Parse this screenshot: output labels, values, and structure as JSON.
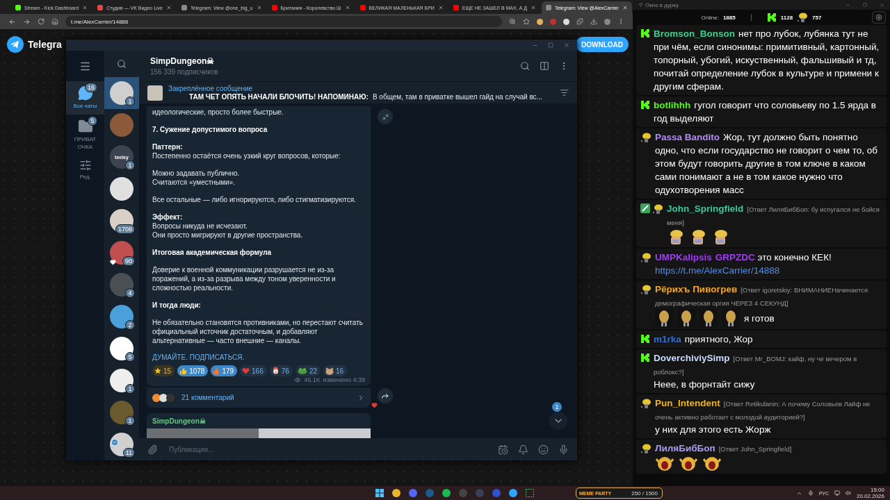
{
  "browser": {
    "tabs": [
      {
        "title": "Stream - Kick Dashboard",
        "kind": "kick",
        "selected": false
      },
      {
        "title": "Студия — VK Видео Live",
        "kind": "vk",
        "selected": false
      },
      {
        "title": "Telegram: View @one_big_u",
        "kind": "web",
        "selected": false
      },
      {
        "title": "Британия - Королевство Ш",
        "kind": "youtube",
        "selected": false
      },
      {
        "title": "ВЕЛИКАЯ МАЛЕНЬКАЯ БРИ",
        "kind": "youtube",
        "selected": false
      },
      {
        "title": "ЕЩЕ НЕ ЗАШЕЛ В MAX, А Д",
        "kind": "youtube",
        "selected": false
      },
      {
        "title": "Telegram: View @AlexCarrier",
        "kind": "web",
        "selected": true
      }
    ],
    "url": "t.me/AlexCarrier/14888"
  },
  "telegram_page": {
    "brand": "Telegra",
    "download_button": "DOWNLOAD"
  },
  "telegram_window": {
    "folders": [
      {
        "label": "Все чаты",
        "badge": "16",
        "kind": "chats",
        "selected": true
      },
      {
        "label": "ПРИВАТОЧКА",
        "badge": "5",
        "kind": "folder",
        "selected": false
      },
      {
        "label": "Ред.",
        "kind": "edit",
        "selected": false
      }
    ],
    "chats": [
      {
        "badge": "1",
        "kind": "plain",
        "selected": true
      },
      {
        "kind": "plain",
        "selected": false
      },
      {
        "label": "teelsy",
        "badge": "1",
        "kind": "text",
        "selected": false
      },
      {
        "kind": "plain",
        "selected": false
      },
      {
        "badge": "1708",
        "kind": "plain",
        "selected": false
      },
      {
        "badge": "90",
        "kind": "reacted",
        "selected": false
      },
      {
        "badge": "4",
        "kind": "plain",
        "selected": false
      },
      {
        "badge": "2",
        "kind": "plain",
        "selected": false
      },
      {
        "badge": "5",
        "kind": "plain",
        "selected": false
      },
      {
        "badge": "1",
        "kind": "plain",
        "selected": false
      },
      {
        "badge": "1",
        "kind": "plain",
        "selected": false
      },
      {
        "badge": "11",
        "kind": "verified",
        "selected": false
      }
    ],
    "channel": {
      "name": "SimpDungeon☠",
      "subscribers": "156 339 подписчиков"
    },
    "pinned": {
      "title": "Закреплённое сообщение",
      "text": "ТАМ ЧЕТ ОПЯТЬ НАЧАЛИ БЛОЧИТЬ! НАПОМИНАЮ:",
      "preview": "В общем, там в приватке вышел гайд на случай вс..."
    },
    "post": {
      "blocks": [
        {
          "lines": [
            "идеологические, просто более быстрые."
          ]
        },
        {
          "title": "7. Сужение допустимого вопроса"
        },
        {
          "title": "Паттерн:",
          "lines": [
            "Постепенно остаётся очень узкий круг вопросов, которые:"
          ]
        },
        {
          "lines": [
            "Можно задавать публично.",
            "Считаются «уместными»."
          ]
        },
        {
          "lines": [
            "Все остальные — либо игнорируются, либо стигматизируются."
          ]
        },
        {
          "title": "Эффект:",
          "lines": [
            "Вопросы никуда не исчезают.",
            "Они просто мигрируют в другие пространства."
          ]
        },
        {
          "title": "Итоговая академическая формула"
        },
        {
          "lines": [
            "Доверие к военной коммуникации разрушается не из-за поражений, а из-за разрыва между тоном уверенности и сложностью реальности."
          ]
        },
        {
          "title": "И тогда люди:"
        },
        {
          "lines": [
            "Не обязательно становятся противниками, но перестают считать официальный источник достаточным, и добавляют альтернативные — часто внешние — каналы."
          ]
        }
      ],
      "link": "ДУМАЙТЕ. ПОДПИСАТЬСЯ.",
      "reactions": [
        {
          "kind": "star",
          "count": "15",
          "selected": false
        },
        {
          "kind": "thumb",
          "count": "1078",
          "selected": true
        },
        {
          "kind": "fire",
          "count": "179",
          "selected": true
        },
        {
          "kind": "heart",
          "count": "166",
          "selected": false
        },
        {
          "kind": "clown",
          "count": "76",
          "selected": false
        },
        {
          "kind": "frog",
          "count": "22",
          "selected": false
        },
        {
          "kind": "bear",
          "count": "16",
          "selected": false
        }
      ],
      "views": "46.1K",
      "edited": "изменено 4:39",
      "comments": "21 комментарий"
    },
    "next_post": {
      "author": "SimpDungeon☠"
    },
    "unread_badge": "1",
    "composer": {
      "placeholder": "Публикация..."
    }
  },
  "chat_panel": {
    "title": "Окно в дурку",
    "online_label": "Online:",
    "online": "1885",
    "kick_count": "1128",
    "emote_count": "757",
    "messages": [
      {
        "badges": [
          {
            "kind": "kick"
          }
        ],
        "name": "Bromson_Bonson",
        "color": "#3fcf8e",
        "text": "нет про лубок, лубянка тут не при чём, если синонимы: примитивный, картонный, топорный, убогий, искуственный, фальшивый и тд, почитай определение лубок в культуре и примени к другим сферам."
      },
      {
        "badges": [
          {
            "kind": "kick"
          }
        ],
        "name": "botlihhh",
        "color": "#53fc18",
        "text": "гугол говорит что соловьеву по 1.5 ярда в год выделяют"
      },
      {
        "badges": [
          {
            "kind": "emote"
          }
        ],
        "name": "Passa Bandito",
        "color": "#b48cf0",
        "text": "Жор, тут должно быть понятно одно, что если государство не говорит о чем то, об этом будут говорить другие в том ключе в каком сами понимают а не в том какое нужно что одухотворения масс"
      },
      {
        "badges": [
          {
            "kind": "pencil"
          },
          {
            "kind": "emote"
          }
        ],
        "name": "John_Springfield",
        "color": "#3ec7a0",
        "reply": "[Ответ ЛиляБибБоп: бу испугался не бойся меня]",
        "emotes": [
          {
            "kind": "cartoon"
          },
          {
            "kind": "cartoon"
          },
          {
            "kind": "cartoon"
          }
        ]
      },
      {
        "badges": [
          {
            "kind": "emote"
          }
        ],
        "name": "UMPKalipsis",
        "color": "#a13cf5",
        "mention": "GRPZDC",
        "text": "это конечно КЕК!",
        "link": "https://t.me/AlexCarrier/14888"
      },
      {
        "badges": [
          {
            "kind": "emote"
          }
        ],
        "name": "Рёрихъ Пивогрев",
        "color": "#f5a623",
        "reply": "[Ответ igoretskiy: ВНИМАНИЕНачинается демографическая оргия ЧЕРЕЗ 4 СЕКУНД]",
        "emotes": [
          {
            "kind": "peanut"
          },
          {
            "kind": "peanut"
          },
          {
            "kind": "peanut"
          },
          {
            "kind": "peanut"
          }
        ],
        "text": "я готов"
      },
      {
        "badges": [
          {
            "kind": "kick"
          }
        ],
        "name": "m1rka",
        "color": "#2f6fd6",
        "text": "приятного, Жор"
      },
      {
        "badges": [
          {
            "kind": "kick"
          }
        ],
        "name": "DoverchiviySimp",
        "color": "#c9dcff",
        "reply": "[Ответ Mr_BOMJ: кайф, ну че вечером в роблокс?]",
        "text": "Неее, в форнтайт сижу"
      },
      {
        "badges": [
          {
            "kind": "emote"
          }
        ],
        "name": "Pun_Intendent",
        "color": "#f0b420",
        "reply": "[Ответ Retikulanin: А почему Соловьев Лайф не очень активно работает с молодой аудиторией?]",
        "text": "у них для этого есть Жорж"
      },
      {
        "badges": [
          {
            "kind": "emote"
          }
        ],
        "name": "ЛиляБибБоп",
        "color": "#a99cf2",
        "reply": "[Ответ John_Springfield]",
        "emotes": [
          {
            "kind": "screaming"
          },
          {
            "kind": "screaming"
          },
          {
            "kind": "screaming"
          }
        ]
      }
    ]
  },
  "taskbar": {
    "widget_title": "MEME PARTY",
    "widget_value": "250 / 1500",
    "language": "РУС",
    "time": "15:00",
    "date": "20.02.2026"
  }
}
